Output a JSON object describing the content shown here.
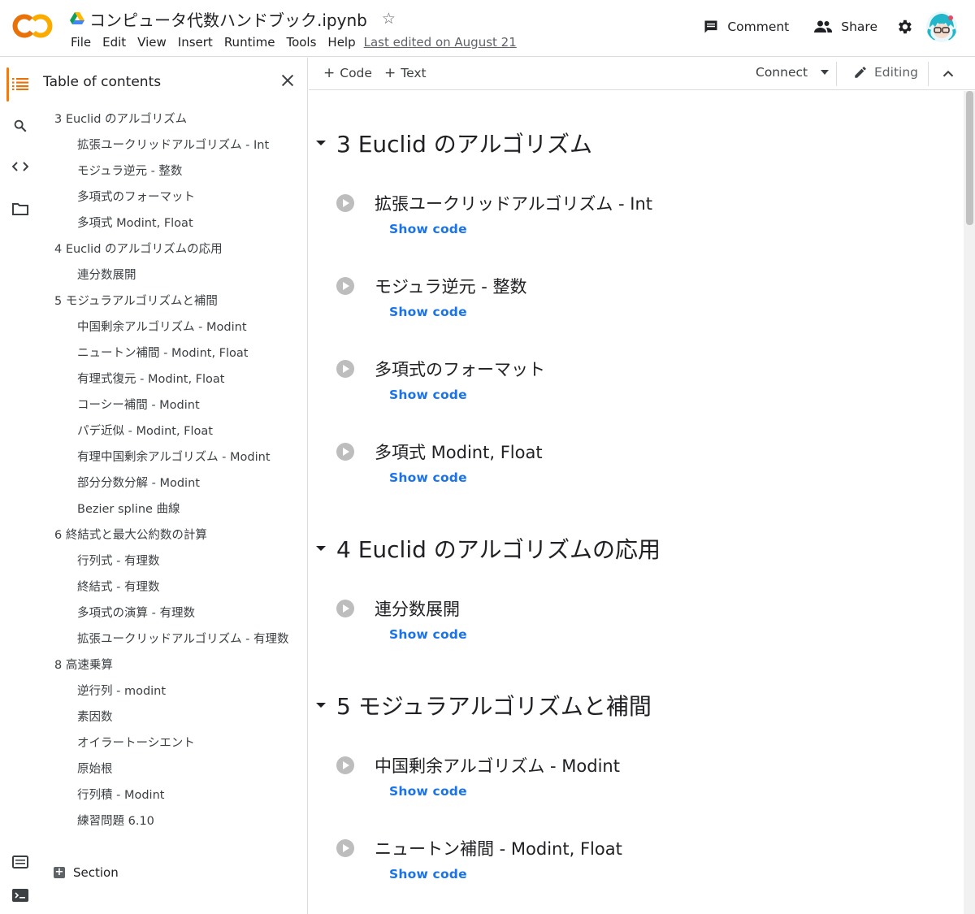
{
  "header": {
    "title": "コンピュータ代数ハンドブック.ipynb",
    "menu": [
      "File",
      "Edit",
      "View",
      "Insert",
      "Runtime",
      "Tools",
      "Help"
    ],
    "last_edited": "Last edited on August 21",
    "comment_label": "Comment",
    "share_label": "Share",
    "logo_text": "CO"
  },
  "colors": {
    "logo_orange": "#f9ab00",
    "logo_dark_orange": "#e8710a",
    "accent_blue": "#1a73e8",
    "active_bar": "#f57c00"
  },
  "toc": {
    "title": "Table of contents",
    "add_section_label": "Section",
    "items": [
      {
        "level": 1,
        "text": "3 Euclid のアルゴリズム"
      },
      {
        "level": 2,
        "text": "拡張ユークリッドアルゴリズム - Int"
      },
      {
        "level": 2,
        "text": "モジュラ逆元 - 整数"
      },
      {
        "level": 2,
        "text": "多項式のフォーマット"
      },
      {
        "level": 2,
        "text": "多項式 Modint, Float"
      },
      {
        "level": 1,
        "text": "4 Euclid のアルゴリズムの応用"
      },
      {
        "level": 2,
        "text": "連分数展開"
      },
      {
        "level": 1,
        "text": "5 モジュラアルゴリズムと補間"
      },
      {
        "level": 2,
        "text": "中国剰余アルゴリズム - Modint"
      },
      {
        "level": 2,
        "text": "ニュートン補間 - Modint, Float"
      },
      {
        "level": 2,
        "text": "有理式復元 - Modint, Float"
      },
      {
        "level": 2,
        "text": "コーシー補間 - Modint"
      },
      {
        "level": 2,
        "text": "パデ近似 - Modint, Float"
      },
      {
        "level": 2,
        "text": "有理中国剰余アルゴリズム - Modint"
      },
      {
        "level": 2,
        "text": "部分分数分解 - Modint"
      },
      {
        "level": 2,
        "text": "Bezier spline 曲線"
      },
      {
        "level": 1,
        "text": "6 終結式と最大公約数の計算"
      },
      {
        "level": 2,
        "text": "行列式 - 有理数"
      },
      {
        "level": 2,
        "text": "終結式 - 有理数"
      },
      {
        "level": 2,
        "text": "多項式の演算 - 有理数"
      },
      {
        "level": 2,
        "text": "拡張ユークリッドアルゴリズム - 有理数"
      },
      {
        "level": 1,
        "text": "8 高速乗算"
      },
      {
        "level": 2,
        "text": "逆行列 - modint"
      },
      {
        "level": 2,
        "text": "素因数"
      },
      {
        "level": 2,
        "text": "オイラートーシエント"
      },
      {
        "level": 2,
        "text": "原始根"
      },
      {
        "level": 2,
        "text": "行列積 - Modint"
      },
      {
        "level": 2,
        "text": "練習問題 6.10"
      }
    ]
  },
  "toolbar": {
    "add_code_label": "Code",
    "add_text_label": "Text",
    "connect_label": "Connect",
    "editing_label": "Editing"
  },
  "notebook": {
    "show_code_label": "Show code",
    "sections": [
      {
        "title": "3 Euclid のアルゴリズム",
        "cells": [
          "拡張ユークリッドアルゴリズム - Int",
          "モジュラ逆元 - 整数",
          "多項式のフォーマット",
          "多項式 Modint, Float"
        ]
      },
      {
        "title": "4 Euclid のアルゴリズムの応用",
        "cells": [
          "連分数展開"
        ]
      },
      {
        "title": "5 モジュラアルゴリズムと補間",
        "cells": [
          "中国剰余アルゴリズム - Modint",
          "ニュートン補間 - Modint, Float"
        ]
      }
    ]
  }
}
